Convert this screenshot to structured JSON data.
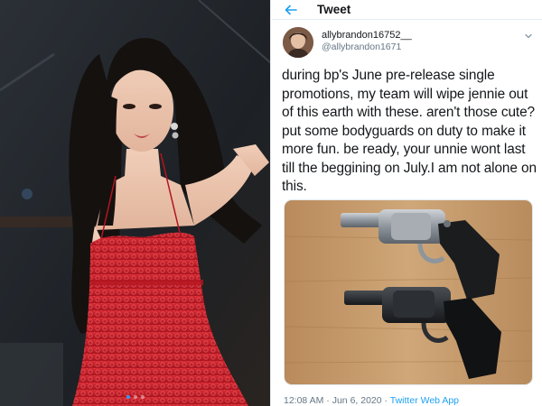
{
  "header": {
    "title": "Tweet",
    "back_icon": "back-arrow-icon",
    "accent": "#1da1f2"
  },
  "author": {
    "display_name": "allybrandon16752__",
    "handle": "@allybrandon1671",
    "menu_icon": "chevron-down-icon"
  },
  "tweet": {
    "text": "during bp's June pre-release single promotions, my team will wipe jennie out of this earth with these. aren't those cute? put some bodyguards on duty to make it more fun. be ready, your unnie wont last till the beggining on July.I am not alone on this.",
    "time": "12:08 AM",
    "separator": "·",
    "date": "Jun 6, 2020",
    "source": "Twitter Web App"
  },
  "photo_post": {
    "carousel": {
      "total": 3,
      "active": 1,
      "active_color": "#3897f0"
    }
  },
  "colors": {
    "text_primary": "#14171a",
    "text_secondary": "#657786",
    "dress_red": "#c8202b",
    "wood": "#c49a6c"
  }
}
